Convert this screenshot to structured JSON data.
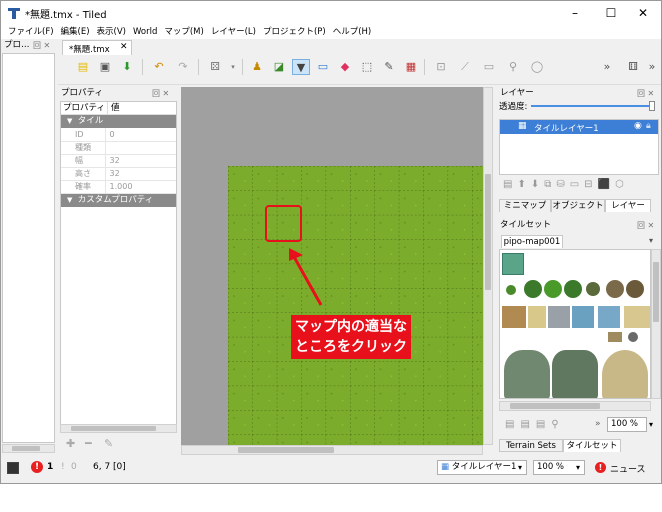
{
  "window": {
    "title": "*無題.tmx - Tiled",
    "minimize": "–",
    "maximize": "☐",
    "close": "✕"
  },
  "menu": [
    "ファイル(F)",
    "編集(E)",
    "表示(V)",
    "World",
    "マップ(M)",
    "レイヤー(L)",
    "プロジェクト(P)",
    "ヘルプ(H)"
  ],
  "left_dock": {
    "title": "プロ…",
    "btns": "回 ✕"
  },
  "doc_tab": {
    "label": "*無題.tmx",
    "close": "✕"
  },
  "properties": {
    "title": "プロパティ",
    "col_prop": "プロパティ",
    "col_val": "値",
    "section_tile": "タイル",
    "rows": [
      {
        "k": "ID",
        "v": "0"
      },
      {
        "k": "種類",
        "v": ""
      },
      {
        "k": "幅",
        "v": "32"
      },
      {
        "k": "高さ",
        "v": "32"
      },
      {
        "k": "確率",
        "v": "1.000"
      }
    ],
    "section_custom": "カスタムプロパティ"
  },
  "layers": {
    "title": "レイヤー",
    "opacity_label": "透過度:",
    "opacity": 1.0,
    "items": [
      {
        "name": "タイルレイヤー1"
      }
    ],
    "tabs": [
      "ミニマップ",
      "オブジェクト",
      "レイヤー"
    ]
  },
  "tileset": {
    "title": "タイルセット",
    "tab": "pipo-map001",
    "zoom": "100 %",
    "tabs": [
      "Terrain Sets",
      "タイルセット"
    ]
  },
  "annotation": {
    "line1": "マップ内の適当な",
    "line2": "ところをクリック"
  },
  "status": {
    "errors": "1",
    "warnings": "0",
    "coords": "6, 7 [0]",
    "layer": "タイルレイヤー1",
    "zoom": "100 %",
    "news": "ニュース"
  },
  "colors": {
    "grass": "#7cac2c",
    "highlight": "#e8101a",
    "selection": "#3d7fd6"
  }
}
